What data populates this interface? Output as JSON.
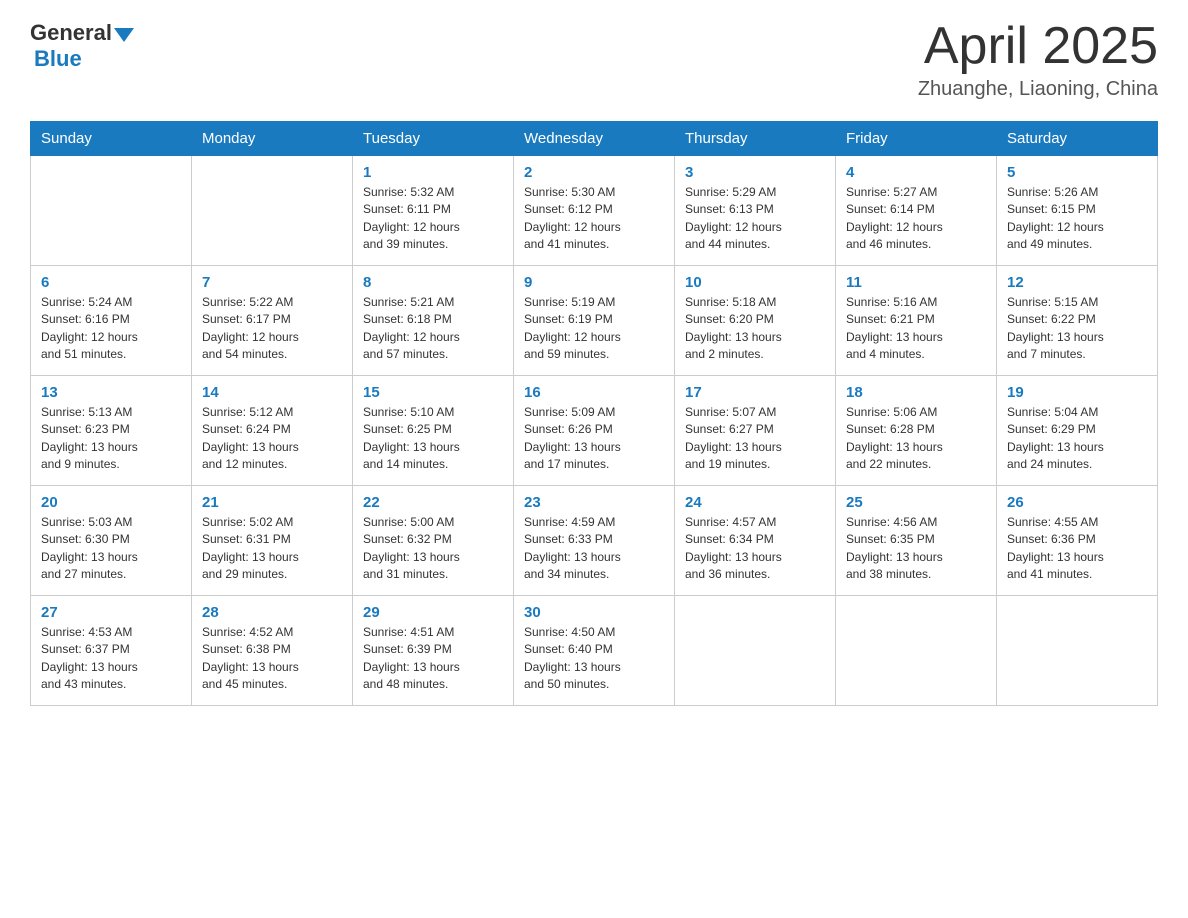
{
  "header": {
    "logo_general": "General",
    "logo_blue": "Blue",
    "title": "April 2025",
    "subtitle": "Zhuanghe, Liaoning, China"
  },
  "days_of_week": [
    "Sunday",
    "Monday",
    "Tuesday",
    "Wednesday",
    "Thursday",
    "Friday",
    "Saturday"
  ],
  "weeks": [
    [
      {
        "day": "",
        "info": ""
      },
      {
        "day": "",
        "info": ""
      },
      {
        "day": "1",
        "info": "Sunrise: 5:32 AM\nSunset: 6:11 PM\nDaylight: 12 hours\nand 39 minutes."
      },
      {
        "day": "2",
        "info": "Sunrise: 5:30 AM\nSunset: 6:12 PM\nDaylight: 12 hours\nand 41 minutes."
      },
      {
        "day": "3",
        "info": "Sunrise: 5:29 AM\nSunset: 6:13 PM\nDaylight: 12 hours\nand 44 minutes."
      },
      {
        "day": "4",
        "info": "Sunrise: 5:27 AM\nSunset: 6:14 PM\nDaylight: 12 hours\nand 46 minutes."
      },
      {
        "day": "5",
        "info": "Sunrise: 5:26 AM\nSunset: 6:15 PM\nDaylight: 12 hours\nand 49 minutes."
      }
    ],
    [
      {
        "day": "6",
        "info": "Sunrise: 5:24 AM\nSunset: 6:16 PM\nDaylight: 12 hours\nand 51 minutes."
      },
      {
        "day": "7",
        "info": "Sunrise: 5:22 AM\nSunset: 6:17 PM\nDaylight: 12 hours\nand 54 minutes."
      },
      {
        "day": "8",
        "info": "Sunrise: 5:21 AM\nSunset: 6:18 PM\nDaylight: 12 hours\nand 57 minutes."
      },
      {
        "day": "9",
        "info": "Sunrise: 5:19 AM\nSunset: 6:19 PM\nDaylight: 12 hours\nand 59 minutes."
      },
      {
        "day": "10",
        "info": "Sunrise: 5:18 AM\nSunset: 6:20 PM\nDaylight: 13 hours\nand 2 minutes."
      },
      {
        "day": "11",
        "info": "Sunrise: 5:16 AM\nSunset: 6:21 PM\nDaylight: 13 hours\nand 4 minutes."
      },
      {
        "day": "12",
        "info": "Sunrise: 5:15 AM\nSunset: 6:22 PM\nDaylight: 13 hours\nand 7 minutes."
      }
    ],
    [
      {
        "day": "13",
        "info": "Sunrise: 5:13 AM\nSunset: 6:23 PM\nDaylight: 13 hours\nand 9 minutes."
      },
      {
        "day": "14",
        "info": "Sunrise: 5:12 AM\nSunset: 6:24 PM\nDaylight: 13 hours\nand 12 minutes."
      },
      {
        "day": "15",
        "info": "Sunrise: 5:10 AM\nSunset: 6:25 PM\nDaylight: 13 hours\nand 14 minutes."
      },
      {
        "day": "16",
        "info": "Sunrise: 5:09 AM\nSunset: 6:26 PM\nDaylight: 13 hours\nand 17 minutes."
      },
      {
        "day": "17",
        "info": "Sunrise: 5:07 AM\nSunset: 6:27 PM\nDaylight: 13 hours\nand 19 minutes."
      },
      {
        "day": "18",
        "info": "Sunrise: 5:06 AM\nSunset: 6:28 PM\nDaylight: 13 hours\nand 22 minutes."
      },
      {
        "day": "19",
        "info": "Sunrise: 5:04 AM\nSunset: 6:29 PM\nDaylight: 13 hours\nand 24 minutes."
      }
    ],
    [
      {
        "day": "20",
        "info": "Sunrise: 5:03 AM\nSunset: 6:30 PM\nDaylight: 13 hours\nand 27 minutes."
      },
      {
        "day": "21",
        "info": "Sunrise: 5:02 AM\nSunset: 6:31 PM\nDaylight: 13 hours\nand 29 minutes."
      },
      {
        "day": "22",
        "info": "Sunrise: 5:00 AM\nSunset: 6:32 PM\nDaylight: 13 hours\nand 31 minutes."
      },
      {
        "day": "23",
        "info": "Sunrise: 4:59 AM\nSunset: 6:33 PM\nDaylight: 13 hours\nand 34 minutes."
      },
      {
        "day": "24",
        "info": "Sunrise: 4:57 AM\nSunset: 6:34 PM\nDaylight: 13 hours\nand 36 minutes."
      },
      {
        "day": "25",
        "info": "Sunrise: 4:56 AM\nSunset: 6:35 PM\nDaylight: 13 hours\nand 38 minutes."
      },
      {
        "day": "26",
        "info": "Sunrise: 4:55 AM\nSunset: 6:36 PM\nDaylight: 13 hours\nand 41 minutes."
      }
    ],
    [
      {
        "day": "27",
        "info": "Sunrise: 4:53 AM\nSunset: 6:37 PM\nDaylight: 13 hours\nand 43 minutes."
      },
      {
        "day": "28",
        "info": "Sunrise: 4:52 AM\nSunset: 6:38 PM\nDaylight: 13 hours\nand 45 minutes."
      },
      {
        "day": "29",
        "info": "Sunrise: 4:51 AM\nSunset: 6:39 PM\nDaylight: 13 hours\nand 48 minutes."
      },
      {
        "day": "30",
        "info": "Sunrise: 4:50 AM\nSunset: 6:40 PM\nDaylight: 13 hours\nand 50 minutes."
      },
      {
        "day": "",
        "info": ""
      },
      {
        "day": "",
        "info": ""
      },
      {
        "day": "",
        "info": ""
      }
    ]
  ]
}
